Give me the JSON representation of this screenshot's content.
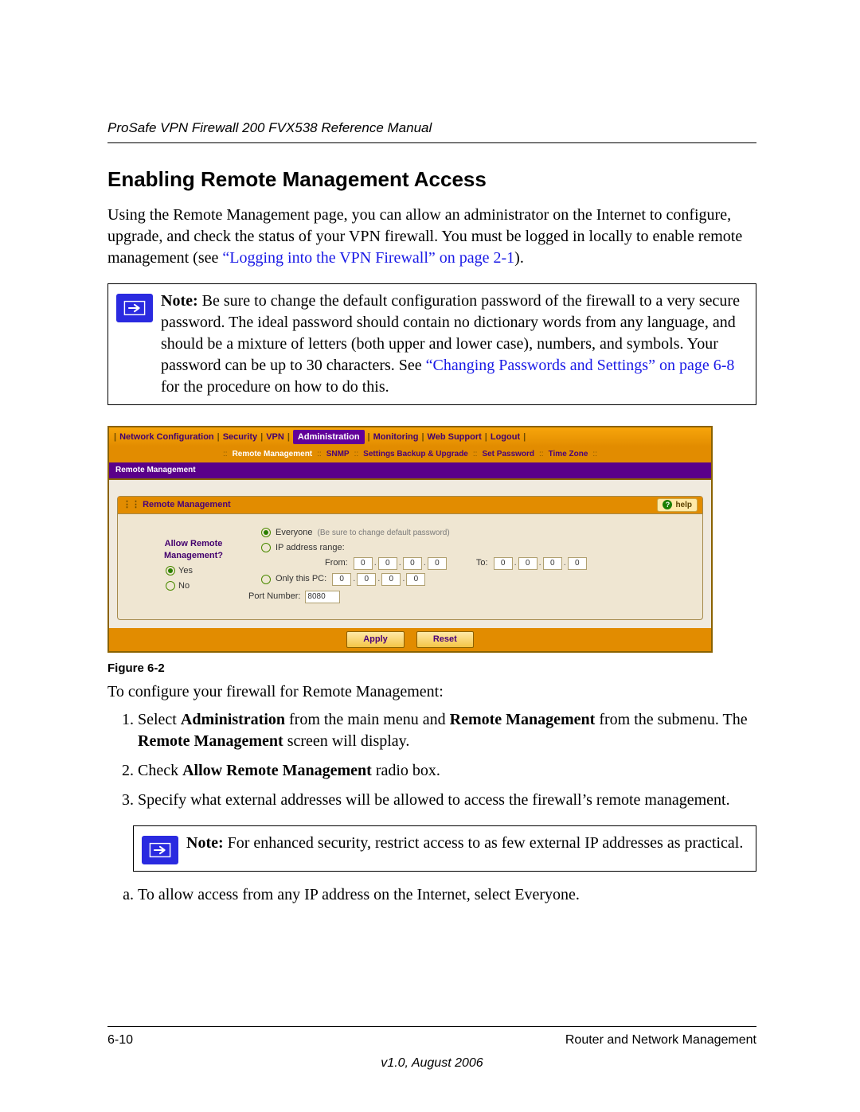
{
  "running_head": "ProSafe VPN Firewall 200 FVX538 Reference Manual",
  "section_title": "Enabling Remote Management Access",
  "intro": {
    "pre": "Using the Remote Management page, you can allow an administrator on the Internet to configure, upgrade, and check the status of your VPN firewall. You must be logged in locally to enable remote management (see ",
    "link": "“Logging into the VPN Firewall” on page 2-1",
    "post": ")."
  },
  "note1": {
    "label": "Note:",
    "body_pre": " Be sure to change the default configuration password of the firewall to a very secure password. The ideal password should contain no dictionary words from any language, and should be a mixture of letters (both upper and lower case), numbers, and symbols. Your password can be up to 30 characters. See ",
    "link": "“Changing Passwords and Settings” on page 6-8",
    "body_post": " for the procedure on how to do this."
  },
  "shot": {
    "tabs": [
      "Network Configuration",
      "Security",
      "VPN",
      "Administration",
      "Monitoring",
      "Web Support",
      "Logout"
    ],
    "active_tab": "Administration",
    "subtabs": [
      "Remote Management",
      "SNMP",
      "Settings Backup & Upgrade",
      "Set Password",
      "Time Zone"
    ],
    "active_subtab": "Remote Management",
    "crumb": "Remote Management",
    "panel_title": "Remote Management",
    "help_label": "help",
    "left": {
      "q1": "Allow Remote",
      "q2": "Management?",
      "yes": "Yes",
      "no": "No"
    },
    "opts": {
      "everyone": "Everyone",
      "everyone_hint": "(Be sure to change default password)",
      "range": "IP address range:",
      "from": "From:",
      "to": "To:",
      "only": "Only this PC:",
      "port_label": "Port Number:",
      "port_value": "8080",
      "ip_zero": "0"
    },
    "buttons": {
      "apply": "Apply",
      "reset": "Reset"
    }
  },
  "figure_label": "Figure 6-2",
  "intro2": "To configure your firewall for Remote Management:",
  "steps": {
    "s1_pre": "Select ",
    "s1_b1": "Administration",
    "s1_mid1": " from the main menu and ",
    "s1_b2": "Remote Management",
    "s1_mid2": " from the submenu. The ",
    "s1_b3": "Remote Management",
    "s1_post": " screen will display.",
    "s2_pre": "Check ",
    "s2_b": "Allow Remote Management",
    "s2_post": " radio box.",
    "s3": "Specify what external addresses will be allowed to access the firewall’s remote management."
  },
  "note2": {
    "label": "Note:",
    "body": " For enhanced security, restrict access to as few external IP addresses as practical."
  },
  "sub_a": "To allow access from any IP address on the Internet, select Everyone.",
  "footer": {
    "left": "6-10",
    "right": "Router and Network Management",
    "version": "v1.0, August 2006"
  }
}
